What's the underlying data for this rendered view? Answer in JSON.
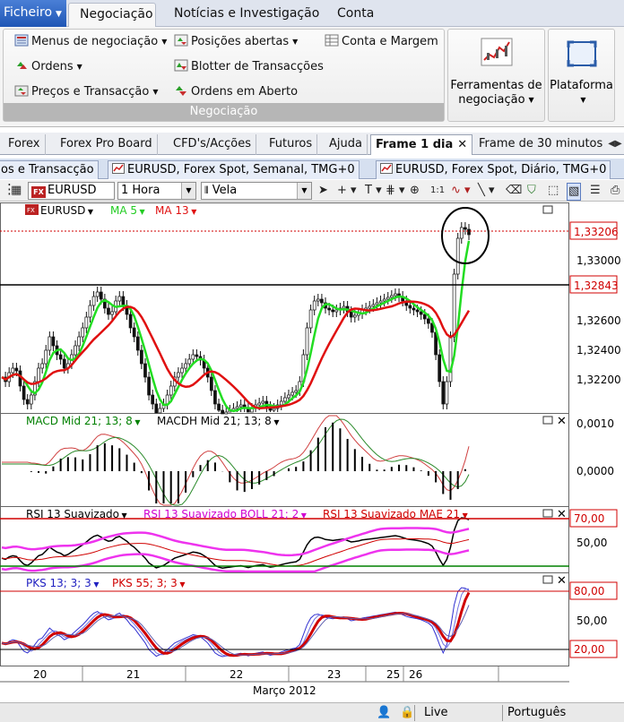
{
  "ribbon_tabs": {
    "file": "Ficheiro",
    "tabs": [
      "Negociação",
      "Notícias e Investigação",
      "Conta"
    ]
  },
  "ribbon": {
    "items": {
      "menus": "Menus de negociação",
      "orders": "Ordens",
      "prices": "Preços e Transacção",
      "positions": "Posições abertas",
      "blotter": "Blotter de Transacções",
      "open_orders": "Ordens em Aberto",
      "account": "Conta e Margem"
    },
    "group_label": "Negociação",
    "tools_label_1": "Ferramentas de",
    "tools_label_2": "negociação",
    "platform_label": "Plataforma"
  },
  "workspace_tabs": [
    "Forex",
    "Forex Pro Board",
    "CFD's/Acções",
    "Futuros",
    "Ajuda",
    "Frame 1 dia",
    "Frame de 30 minutos"
  ],
  "workspace_active": "Frame 1 dia",
  "chart_tabs": [
    "os e Transacção",
    "EURUSD, Forex Spot, Semanal, TMG+0",
    "EURUSD, Forex Spot, Diário, TMG+0"
  ],
  "toolbar": {
    "symbol": "EURUSD",
    "timeframe": "1 Hora",
    "chart_type": "Vela",
    "tool_11": "1:1"
  },
  "price_panel": {
    "symbol": "EURUSD",
    "ma5": "MA 5",
    "ma13": "MA 13",
    "last_price": "1,33206",
    "hline_price": "1,32843",
    "ticks": [
      "1,33000",
      "1,32600",
      "1,32400",
      "1,32200"
    ]
  },
  "macd_panel": {
    "label1": "MACD Mid  21; 13; 8",
    "label2": "MACDH Mid  21; 13; 8",
    "ticks": [
      "0,0010",
      "0,0000"
    ]
  },
  "rsi_panel": {
    "label1": "RSI 13 Suavizado",
    "label2": "RSI 13 Suavizado BOLL 21; 2",
    "label3": "RSI 13 Suavizado MAE 21",
    "ticks": [
      "70,00",
      "50,00"
    ]
  },
  "pks_panel": {
    "label1": "PKS 13; 3; 3",
    "label2": "PKS 55; 3; 3",
    "ticks": [
      "80,00",
      "50,00",
      "20,00"
    ]
  },
  "x_axis": {
    "days": [
      "20",
      "21",
      "22",
      "23",
      "25",
      "26"
    ],
    "month": "Março 2012"
  },
  "status": {
    "live": "Live",
    "language": "Português"
  },
  "colors": {
    "ma5": "#22dd22",
    "ma13": "#e01010",
    "last_price": "#d00000",
    "rsi_band": "#ee33ee"
  }
}
